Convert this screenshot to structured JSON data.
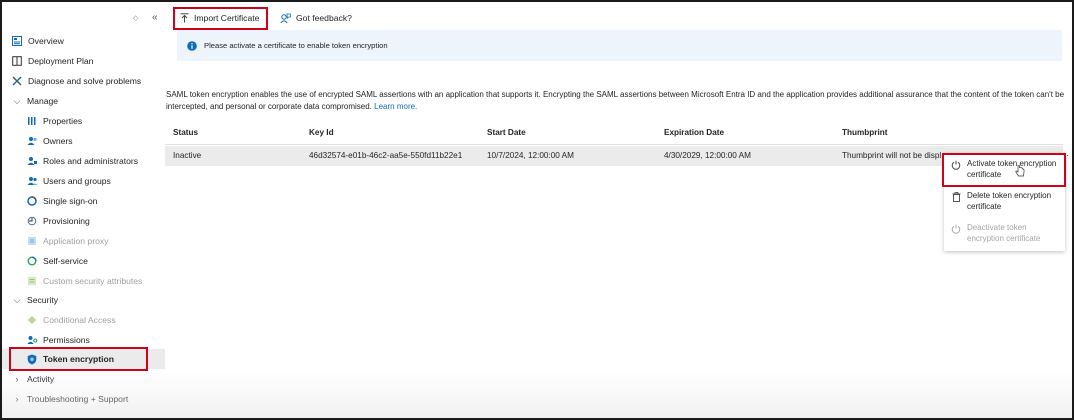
{
  "sidebar": {
    "items": [
      {
        "label": "Overview",
        "icon": "overview-icon"
      },
      {
        "label": "Deployment Plan",
        "icon": "book-icon"
      },
      {
        "label": "Diagnose and solve problems",
        "icon": "wrench-icon"
      },
      {
        "label": "Manage",
        "icon": "chevron-down-icon"
      },
      {
        "label": "Properties",
        "icon": "properties-icon"
      },
      {
        "label": "Owners",
        "icon": "owners-icon"
      },
      {
        "label": "Roles and administrators",
        "icon": "roles-icon"
      },
      {
        "label": "Users and groups",
        "icon": "users-icon"
      },
      {
        "label": "Single sign-on",
        "icon": "sso-icon"
      },
      {
        "label": "Provisioning",
        "icon": "provisioning-icon"
      },
      {
        "label": "Application proxy",
        "icon": "app-proxy-icon"
      },
      {
        "label": "Self-service",
        "icon": "self-service-icon"
      },
      {
        "label": "Custom security attributes",
        "icon": "custom-attributes-icon"
      },
      {
        "label": "Security",
        "icon": "chevron-down-icon"
      },
      {
        "label": "Conditional Access",
        "icon": "conditional-access-icon"
      },
      {
        "label": "Permissions",
        "icon": "permissions-icon"
      },
      {
        "label": "Token encryption",
        "icon": "shield-icon"
      },
      {
        "label": "Activity",
        "icon": "chevron-right-icon"
      },
      {
        "label": "Troubleshooting + Support",
        "icon": "chevron-right-icon"
      }
    ]
  },
  "toolbar": {
    "import_label": "Import Certificate",
    "feedback_label": "Got feedback?"
  },
  "banner": {
    "text": "Please activate a certificate to enable token encryption"
  },
  "description": {
    "line1": "SAML token encryption enables the use of encrypted SAML assertions with an application that supports it. Encrypting the SAML assertions between Microsoft Entra ID and the application provides additional assurance that the content of the token can't be",
    "line2": "intercepted, and personal or corporate data compromised.",
    "link": "Learn more."
  },
  "table": {
    "headers": [
      "Status",
      "Key Id",
      "Start Date",
      "Expiration Date",
      "Thumbprint"
    ],
    "row": {
      "status": "Inactive",
      "key_id": "46d32574-e01b-46c2-aa5e-550fd11b22e1",
      "start_date": "10/7/2024, 12:00:00 AM",
      "expiration_date": "4/30/2029, 12:00:00 AM",
      "thumbprint": "Thumbprint will not be displ"
    }
  },
  "context_menu": {
    "items": [
      {
        "label": "Activate token encryption certificate",
        "icon": "power-icon"
      },
      {
        "label": "Delete token encryption certificate",
        "icon": "trash-icon"
      },
      {
        "label": "Deactivate token encryption certificate",
        "icon": "power-icon"
      }
    ]
  },
  "colors": {
    "highlight": "#d0021b",
    "accent": "#0f6cbd",
    "banner_bg": "#eef4fb",
    "selected_bg": "#ebebeb"
  }
}
